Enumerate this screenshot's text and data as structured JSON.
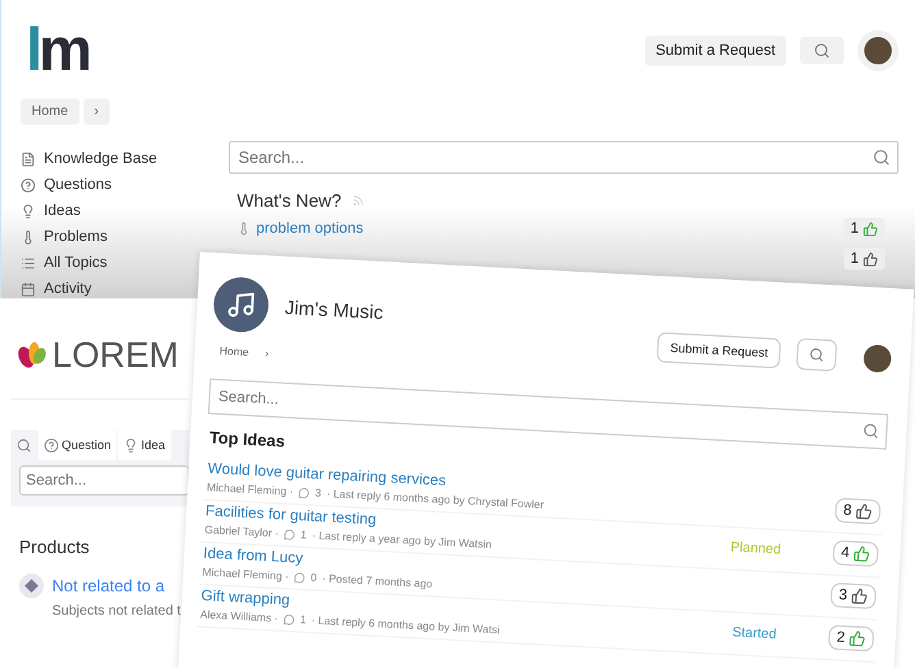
{
  "back_site": {
    "logo": "lm",
    "submit_button": "Submit a Request",
    "breadcrumb": [
      "Home",
      "›"
    ],
    "sidebar": [
      {
        "label": "Knowledge Base"
      },
      {
        "label": "Questions"
      },
      {
        "label": "Ideas"
      },
      {
        "label": "Problems"
      },
      {
        "label": "All Topics"
      },
      {
        "label": "Activity"
      }
    ],
    "search": {
      "placeholder": "Search..."
    },
    "section_title": "What's New?",
    "whats_new": [
      {
        "title": "problem options",
        "votes": "1",
        "voted": true
      },
      {
        "votes": "1",
        "voted": false
      }
    ]
  },
  "lorem_site": {
    "logo": "LOREM",
    "tabs": [
      {
        "kind": "search",
        "selected": true
      },
      {
        "kind": "question",
        "label": "Question",
        "selected": false
      },
      {
        "kind": "bulb",
        "label": "Idea",
        "selected": false
      }
    ],
    "search": {
      "placeholder": "Search..."
    },
    "section_title": "Products",
    "product": {
      "title": "Not related to a",
      "subtitle": "Subjects not related t"
    }
  },
  "front_site": {
    "title": "Jim's Music",
    "submit_button": "Submit a Request",
    "breadcrumb": [
      "Home",
      "›"
    ],
    "search": {
      "placeholder": "Search..."
    },
    "section_title": "Top Ideas",
    "ideas": [
      {
        "title": "Would love guitar repairing services",
        "author": "Michael Fleming ·",
        "comments": "3",
        "activity": "· Last reply 6 months ago by Chrystal Fowler",
        "votes": "8",
        "voted": false
      },
      {
        "title": "Facilities for guitar testing",
        "author": "Gabriel Taylor ·",
        "comments": "1",
        "activity": "· Last reply a year ago by Jim Watsin",
        "status": "Planned",
        "color": "#b5c42c",
        "votes": "4",
        "voted": true
      },
      {
        "title": "Idea from Lucy",
        "author": "Michael Fleming ·",
        "comments": "0",
        "activity": "· Posted 7 months ago",
        "votes": "3",
        "voted": false
      },
      {
        "title": "Gift wrapping",
        "author": "Alexa Williams ·",
        "comments": "1",
        "activity": "· Last reply 6 months ago by Jim Watsi",
        "status": "Started",
        "color": "#3a9cc8",
        "votes": "2",
        "voted": true
      }
    ]
  }
}
